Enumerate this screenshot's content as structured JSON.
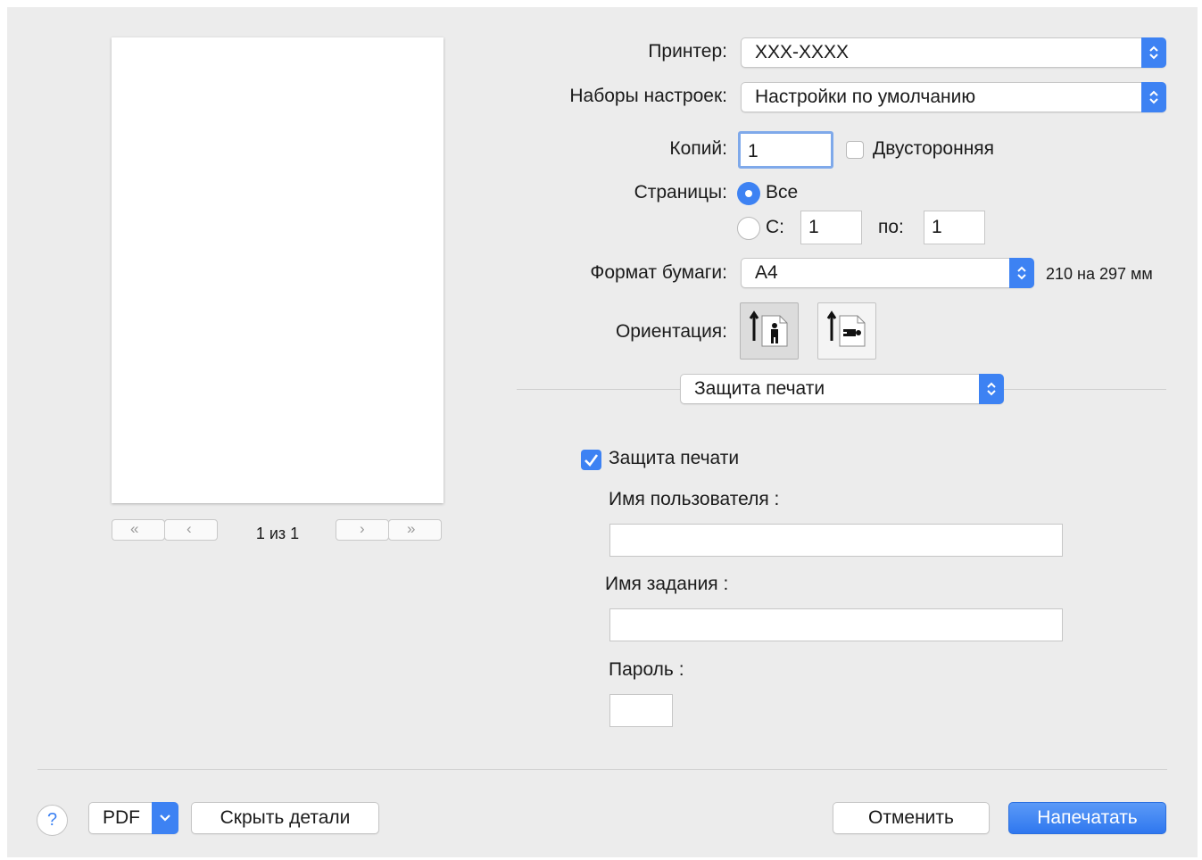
{
  "preview": {
    "page_indicator": "1 из 1"
  },
  "printer": {
    "label": "Принтер:",
    "value": "XXX-XXXX"
  },
  "presets": {
    "label": "Наборы настроек:",
    "value": "Настройки по умолчанию"
  },
  "copies": {
    "label": "Копий:",
    "value": "1",
    "duplex_label": "Двусторонняя",
    "duplex_checked": false
  },
  "pages": {
    "label": "Страницы:",
    "all_label": "Все",
    "from_label": "С:",
    "from_value": "1",
    "to_label": "по:",
    "to_value": "1",
    "selected": "all"
  },
  "paper": {
    "label": "Формат бумаги:",
    "value": "A4",
    "size_text": "210 на 297 мм"
  },
  "orientation": {
    "label": "Ориентация:",
    "selected": "portrait"
  },
  "section": {
    "value": "Защита печати"
  },
  "secure": {
    "checkbox_label": "Защита печати",
    "checked": true,
    "username_label": "Имя пользователя :",
    "username_value": "",
    "jobname_label": "Имя задания :",
    "jobname_value": "",
    "password_label": "Пароль :",
    "password_value": ""
  },
  "footer": {
    "help_label": "?",
    "pdf_label": "PDF",
    "hide_details_label": "Скрыть детали",
    "cancel_label": "Отменить",
    "print_label": "Напечатать"
  },
  "colors": {
    "accent": "#3d82f3",
    "dialog_bg": "#ececec"
  }
}
